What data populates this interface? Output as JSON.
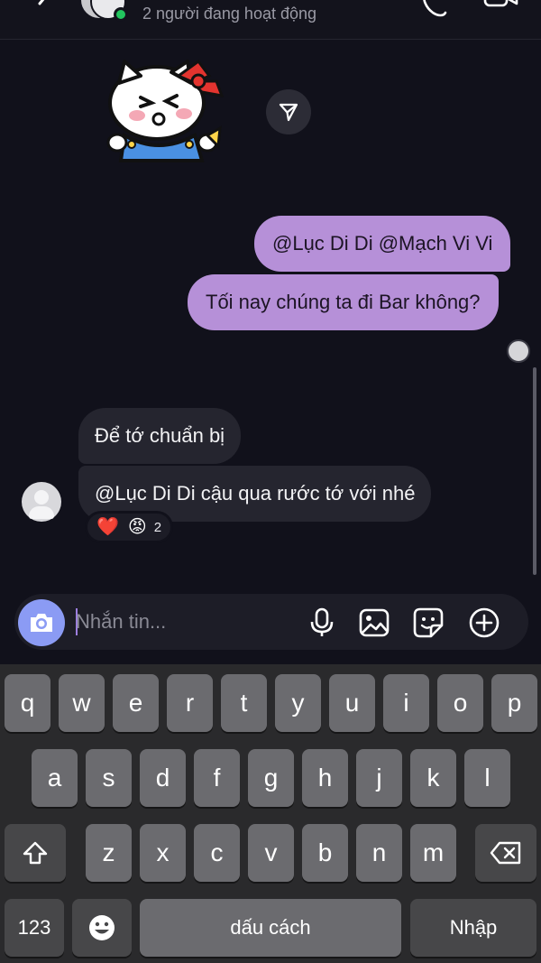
{
  "header": {
    "status": "2 người đang hoạt động"
  },
  "messages": [
    {
      "direction": "outgoing",
      "text": "@Lục Di Di @Mạch Vi Vi"
    },
    {
      "direction": "outgoing",
      "text": "Tối nay chúng ta đi Bar không?"
    },
    {
      "direction": "incoming",
      "text": "Để tớ chuẩn bị"
    },
    {
      "direction": "incoming",
      "text": "@Lục Di Di cậu qua rước tớ với nhé"
    }
  ],
  "reactions": {
    "emojis": [
      "❤️",
      "😡"
    ],
    "count": "2"
  },
  "composer": {
    "placeholder": "Nhắn tin..."
  },
  "keyboard": {
    "row1": [
      "q",
      "w",
      "e",
      "r",
      "t",
      "y",
      "u",
      "i",
      "o",
      "p"
    ],
    "row2": [
      "a",
      "s",
      "d",
      "f",
      "g",
      "h",
      "j",
      "k",
      "l"
    ],
    "row3": [
      "z",
      "x",
      "c",
      "v",
      "b",
      "n",
      "m"
    ],
    "numbers_label": "123",
    "space_label": "dấu cách",
    "return_label": "Nhập"
  },
  "colors": {
    "outgoing_bubble": "#b690d8",
    "incoming_bubble": "#25252f",
    "background": "#11111b",
    "camera_button": "#8b9bf4",
    "online": "#22c55e"
  }
}
